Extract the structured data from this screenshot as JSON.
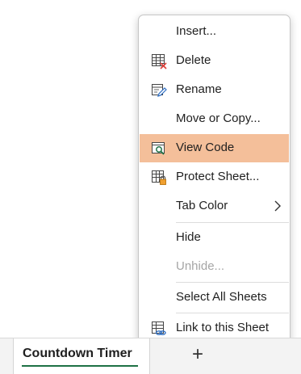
{
  "menu": {
    "insert": "Insert...",
    "delete": "Delete",
    "rename": "Rename",
    "move_copy": "Move or Copy...",
    "view_code": "View Code",
    "protect_sheet": "Protect Sheet...",
    "tab_color": "Tab Color",
    "hide": "Hide",
    "unhide": "Unhide...",
    "select_all": "Select All Sheets",
    "link": "Link to this Sheet"
  },
  "sheet_tab": {
    "label": "Countdown Timer"
  },
  "add_sheet_symbol": "+",
  "colors": {
    "highlight": "#f4bf9a",
    "tab_underline": "#1e7145",
    "delete_x": "#e0443e",
    "lock": "#f0a030"
  },
  "icons": [
    "delete-sheet-icon",
    "rename-icon",
    "view-code-icon",
    "protect-sheet-icon",
    "chevron-right-icon",
    "link-icon"
  ]
}
